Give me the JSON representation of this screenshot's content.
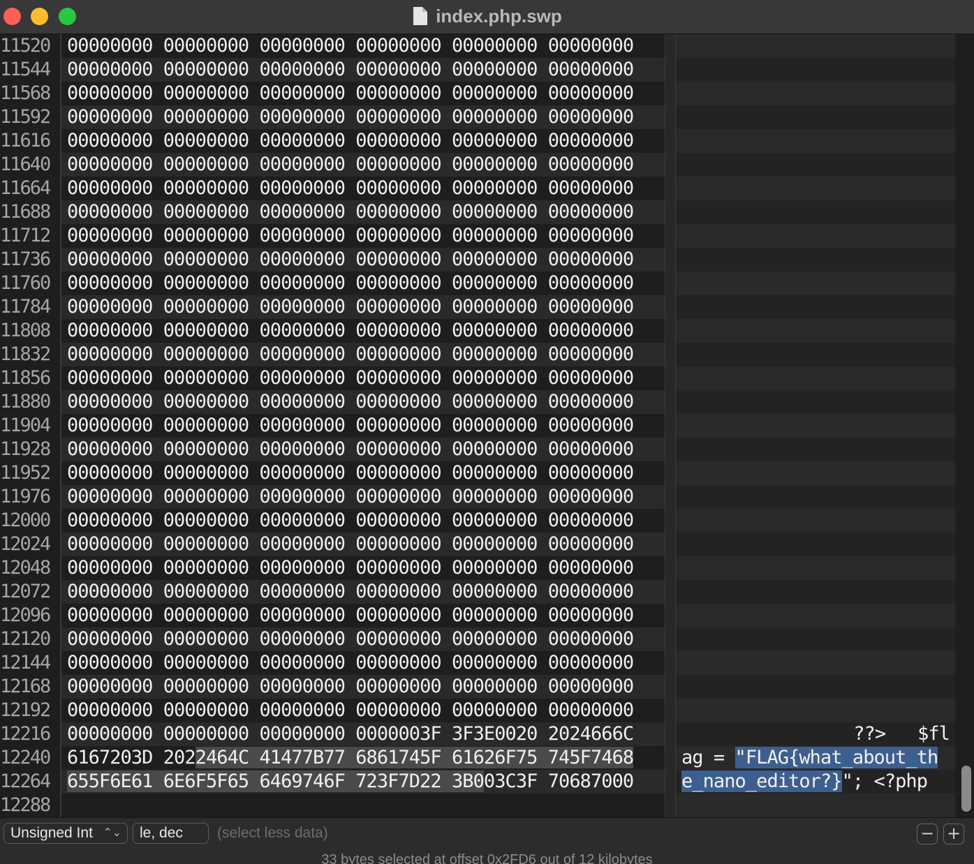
{
  "window": {
    "title": "index.php.swp"
  },
  "rows": [
    {
      "offset": "11520",
      "hex": "00000000 00000000 00000000 00000000 00000000 00000000",
      "ascii": ""
    },
    {
      "offset": "11544",
      "hex": "00000000 00000000 00000000 00000000 00000000 00000000",
      "ascii": ""
    },
    {
      "offset": "11568",
      "hex": "00000000 00000000 00000000 00000000 00000000 00000000",
      "ascii": ""
    },
    {
      "offset": "11592",
      "hex": "00000000 00000000 00000000 00000000 00000000 00000000",
      "ascii": ""
    },
    {
      "offset": "11616",
      "hex": "00000000 00000000 00000000 00000000 00000000 00000000",
      "ascii": ""
    },
    {
      "offset": "11640",
      "hex": "00000000 00000000 00000000 00000000 00000000 00000000",
      "ascii": ""
    },
    {
      "offset": "11664",
      "hex": "00000000 00000000 00000000 00000000 00000000 00000000",
      "ascii": ""
    },
    {
      "offset": "11688",
      "hex": "00000000 00000000 00000000 00000000 00000000 00000000",
      "ascii": ""
    },
    {
      "offset": "11712",
      "hex": "00000000 00000000 00000000 00000000 00000000 00000000",
      "ascii": ""
    },
    {
      "offset": "11736",
      "hex": "00000000 00000000 00000000 00000000 00000000 00000000",
      "ascii": ""
    },
    {
      "offset": "11760",
      "hex": "00000000 00000000 00000000 00000000 00000000 00000000",
      "ascii": ""
    },
    {
      "offset": "11784",
      "hex": "00000000 00000000 00000000 00000000 00000000 00000000",
      "ascii": ""
    },
    {
      "offset": "11808",
      "hex": "00000000 00000000 00000000 00000000 00000000 00000000",
      "ascii": ""
    },
    {
      "offset": "11832",
      "hex": "00000000 00000000 00000000 00000000 00000000 00000000",
      "ascii": ""
    },
    {
      "offset": "11856",
      "hex": "00000000 00000000 00000000 00000000 00000000 00000000",
      "ascii": ""
    },
    {
      "offset": "11880",
      "hex": "00000000 00000000 00000000 00000000 00000000 00000000",
      "ascii": ""
    },
    {
      "offset": "11904",
      "hex": "00000000 00000000 00000000 00000000 00000000 00000000",
      "ascii": ""
    },
    {
      "offset": "11928",
      "hex": "00000000 00000000 00000000 00000000 00000000 00000000",
      "ascii": ""
    },
    {
      "offset": "11952",
      "hex": "00000000 00000000 00000000 00000000 00000000 00000000",
      "ascii": ""
    },
    {
      "offset": "11976",
      "hex": "00000000 00000000 00000000 00000000 00000000 00000000",
      "ascii": ""
    },
    {
      "offset": "12000",
      "hex": "00000000 00000000 00000000 00000000 00000000 00000000",
      "ascii": ""
    },
    {
      "offset": "12024",
      "hex": "00000000 00000000 00000000 00000000 00000000 00000000",
      "ascii": ""
    },
    {
      "offset": "12048",
      "hex": "00000000 00000000 00000000 00000000 00000000 00000000",
      "ascii": ""
    },
    {
      "offset": "12072",
      "hex": "00000000 00000000 00000000 00000000 00000000 00000000",
      "ascii": ""
    },
    {
      "offset": "12096",
      "hex": "00000000 00000000 00000000 00000000 00000000 00000000",
      "ascii": ""
    },
    {
      "offset": "12120",
      "hex": "00000000 00000000 00000000 00000000 00000000 00000000",
      "ascii": ""
    },
    {
      "offset": "12144",
      "hex": "00000000 00000000 00000000 00000000 00000000 00000000",
      "ascii": ""
    },
    {
      "offset": "12168",
      "hex": "00000000 00000000 00000000 00000000 00000000 00000000",
      "ascii": ""
    },
    {
      "offset": "12192",
      "hex": "00000000 00000000 00000000 00000000 00000000 00000000",
      "ascii": ""
    },
    {
      "offset": "12216",
      "hex": "00000000 00000000 00000000 0000003F 3F3E0020 2024666C",
      "ascii": "              ??>   $fl"
    },
    {
      "offset": "12240",
      "hex": "6167203D 2022464C 41477B77 6861745F 61626F75 745F7468",
      "ascii": "ag = \"FLAG{what_about_th"
    },
    {
      "offset": "12264",
      "hex": "655F6E61 6E6F5F65 6469746F 723F7D22 3B003C3F 70687000",
      "ascii": "e_nano_editor?}\"; <?php"
    },
    {
      "offset": "12288",
      "hex": "",
      "ascii": ""
    }
  ],
  "selection": {
    "hex_start": {
      "row": 30,
      "chars": 12
    },
    "hex_end": {
      "row": 31,
      "chars": 39
    },
    "ascii_start": {
      "row": 30,
      "chars": 5
    },
    "ascii_end": {
      "row": 31,
      "chars": 15
    }
  },
  "bottom": {
    "type_select": "Unsigned Int",
    "format_select": "le, dec",
    "hint": "(select less data)",
    "minus_label": "−",
    "plus_label": "+"
  },
  "status": {
    "text": "33 bytes selected at offset 0x2FD6 out of 12 kilobytes"
  }
}
